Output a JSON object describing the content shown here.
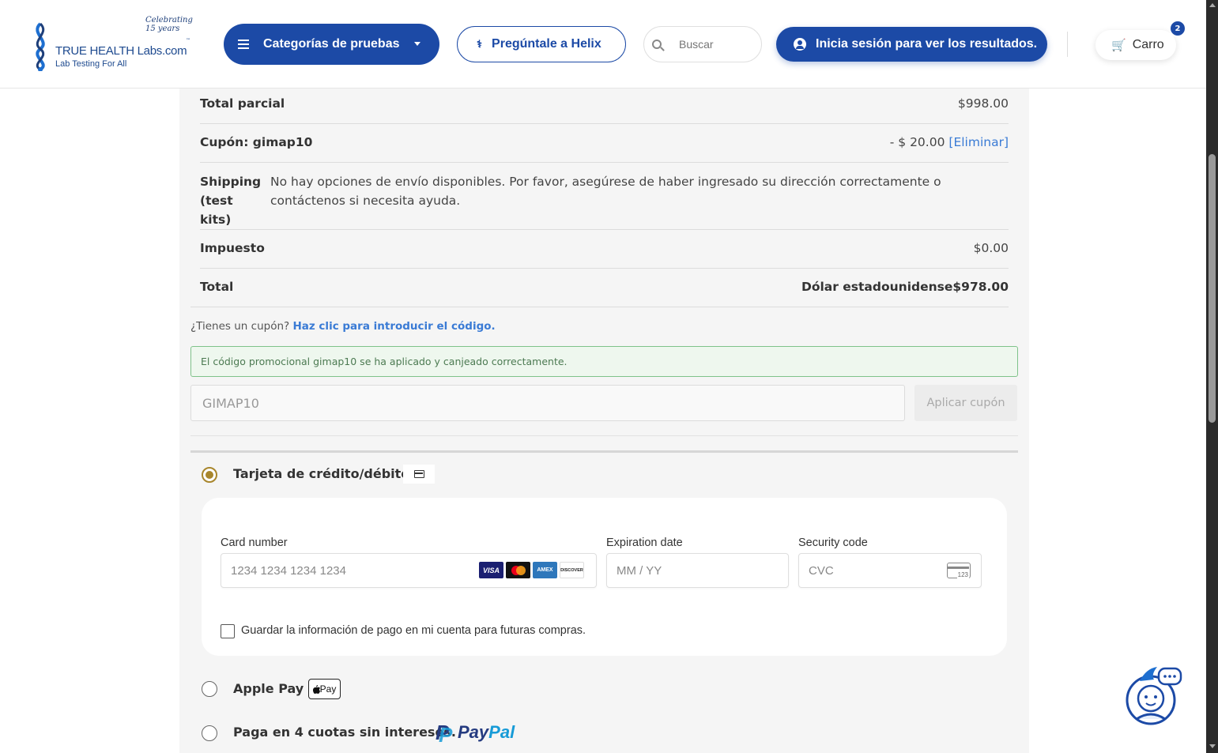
{
  "header": {
    "logo": {
      "celebrating": "Celebrating",
      "years": "15 years",
      "brand": "TRUE HEALTH Labs.com",
      "tm": "™",
      "tagline": "Lab Testing For All"
    },
    "categories_button": "Categorías de pruebas",
    "helix_button": "Pregúntale a Helix",
    "search_placeholder": "Buscar",
    "login_button": "Inicia sesión para ver los resultados.",
    "cart_label": "Carro",
    "cart_count": "2"
  },
  "summary": {
    "subtotal_label": "Total parcial",
    "subtotal_value": "$998.00",
    "coupon_label": "Cupón: gimap10",
    "coupon_value": "- $ 20.00",
    "coupon_remove": "[Eliminar]",
    "shipping_label": "Shipping (test kits)",
    "shipping_text": "No hay opciones de envío disponibles. Por favor, asegúrese de haber ingresado su dirección correctamente o contáctenos si necesita ayuda.",
    "tax_label": "Impuesto",
    "tax_value": "$0.00",
    "total_label": "Total",
    "total_value": "Dólar estadounidense$978.00"
  },
  "coupon": {
    "question": "¿Tienes un cupón?",
    "link": "Haz clic para introducir el código.",
    "success_notice": "El código promocional gimap10 se ha aplicado y canjeado correctamente.",
    "input_value": "GIMAP10",
    "apply_button": "Aplicar cupón"
  },
  "payment": {
    "card_option": "Tarjeta de crédito/débito",
    "card_number_label": "Card number",
    "card_number_placeholder": "1234 1234 1234 1234",
    "expiration_label": "Expiration date",
    "expiration_placeholder": "MM / YY",
    "security_label": "Security code",
    "security_placeholder": "CVC",
    "cvc_icon_text": "123",
    "card_brands": [
      "VISA",
      "mastercard",
      "AMEX",
      "DISCOVER"
    ],
    "save_info_label": "Guardar la información de pago en mi cuenta para futuras compras.",
    "applepay_option": "Apple Pay",
    "applepay_badge": " Pay",
    "paypal_option": "Paga en 4 cuotas sin intereses.",
    "paypal_logo_a": "Pay",
    "paypal_logo_b": "Pal"
  },
  "colors": {
    "primary": "#1c4aa6",
    "radio_selected": "#a8862c",
    "link": "#3a7bd5",
    "success_border": "#7fc28a"
  }
}
